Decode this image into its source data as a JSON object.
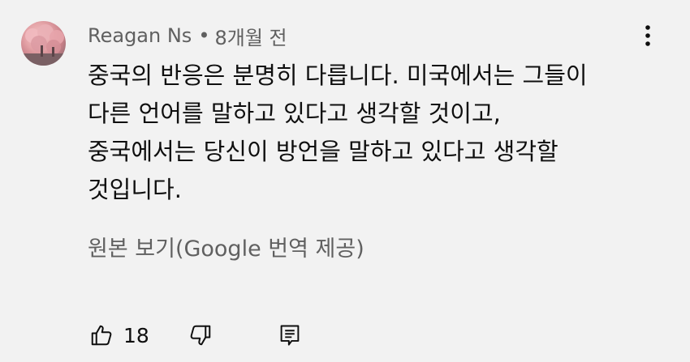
{
  "comment": {
    "author": "Reagan Ns",
    "separator": "•",
    "time": "8개월 전",
    "lines": [
      "중국의 반응은 분명히 다릅니다. 미국에서는 그들이",
      "다른 언어를 말하고 있다고 생각할 것이고,",
      "중국에서는 당신이 방언을 말하고 있다고 생각할",
      "것입니다."
    ],
    "translate_link": "원본 보기(Google 번역 제공)",
    "like_count": "18"
  },
  "icons": {
    "menu": "more-vert-icon",
    "like": "thumbs-up-icon",
    "dislike": "thumbs-down-icon",
    "reply": "reply-comment-icon"
  }
}
